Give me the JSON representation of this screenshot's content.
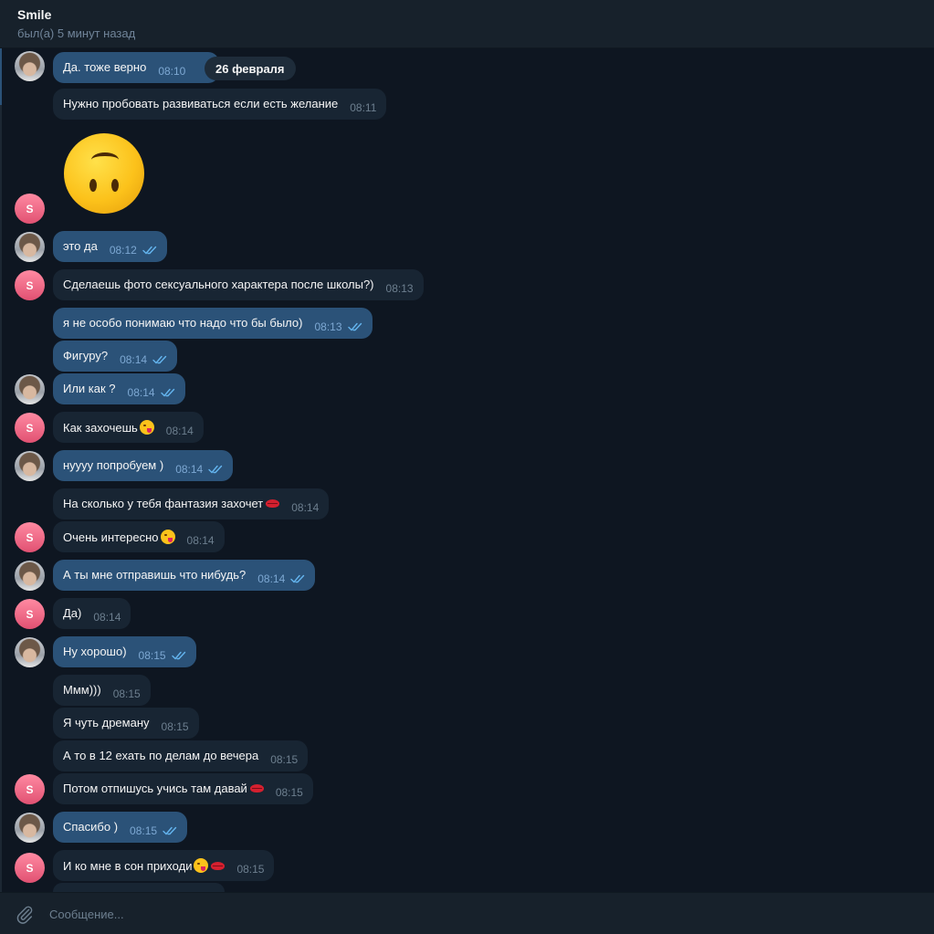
{
  "header": {
    "name": "Smile",
    "status": "был(а) 5 минут назад"
  },
  "date_pill": "26 февраля",
  "colors": {
    "background": "#0e1621",
    "incoming_bubble": "#182533",
    "outgoing_bubble": "#2b5278",
    "accent": "#64b5ef",
    "avatar_letter_bg": "#e15172"
  },
  "avatar_letter": "S",
  "messages": [
    {
      "text": "Да. тоже верно",
      "time": "08:10",
      "dir": "out",
      "read": true
    },
    {
      "text": "Нужно пробовать развиваться если есть желание",
      "time": "08:11",
      "dir": "in"
    },
    {
      "sticker": "upside-down-face",
      "dir": "in"
    },
    {
      "text": "это да",
      "time": "08:12",
      "dir": "out",
      "read": true
    },
    {
      "text": "Сделаешь фото сексуального характера после школы?)",
      "time": "08:13",
      "dir": "in"
    },
    {
      "text": "я не особо понимаю что надо что бы было)",
      "time": "08:13",
      "dir": "out",
      "read": true
    },
    {
      "text": "Фигуру?",
      "time": "08:14",
      "dir": "out",
      "read": true
    },
    {
      "text": "Или как ?",
      "time": "08:14",
      "dir": "out",
      "read": true
    },
    {
      "text": "Как захочешь",
      "emoji": "winking-tongue",
      "time": "08:14",
      "dir": "in"
    },
    {
      "text": "нуууу попробуем )",
      "time": "08:14",
      "dir": "out",
      "read": true
    },
    {
      "text": "На сколько у тебя фантазия захочет",
      "emoji": "kiss-mark",
      "time": "08:14",
      "dir": "in"
    },
    {
      "text": "Очень интересно",
      "emoji": "winking-tongue",
      "time": "08:14",
      "dir": "in"
    },
    {
      "text": "А ты мне отправишь что нибудь?",
      "time": "08:14",
      "dir": "out",
      "read": true
    },
    {
      "text": "Да)",
      "time": "08:14",
      "dir": "in"
    },
    {
      "text": "Ну хорошо)",
      "time": "08:15",
      "dir": "out",
      "read": true
    },
    {
      "text": "Ммм)))",
      "time": "08:15",
      "dir": "in"
    },
    {
      "text": "Я чуть дреману",
      "time": "08:15",
      "dir": "in"
    },
    {
      "text": "А то в 12 ехать по делам до вечера",
      "time": "08:15",
      "dir": "in"
    },
    {
      "text": "Потом отпишусь учись там давай",
      "emoji": "kiss-mark",
      "time": "08:15",
      "dir": "in"
    },
    {
      "text": "Спасибо )",
      "time": "08:15",
      "dir": "out",
      "read": true
    },
    {
      "text": "И ко мне в сон приходи",
      "emoji": "winking-tongue kiss-mark",
      "time": "08:15",
      "dir": "in"
    }
  ],
  "composer": {
    "placeholder": "Сообщение...",
    "attach_icon": "paperclip-icon"
  }
}
